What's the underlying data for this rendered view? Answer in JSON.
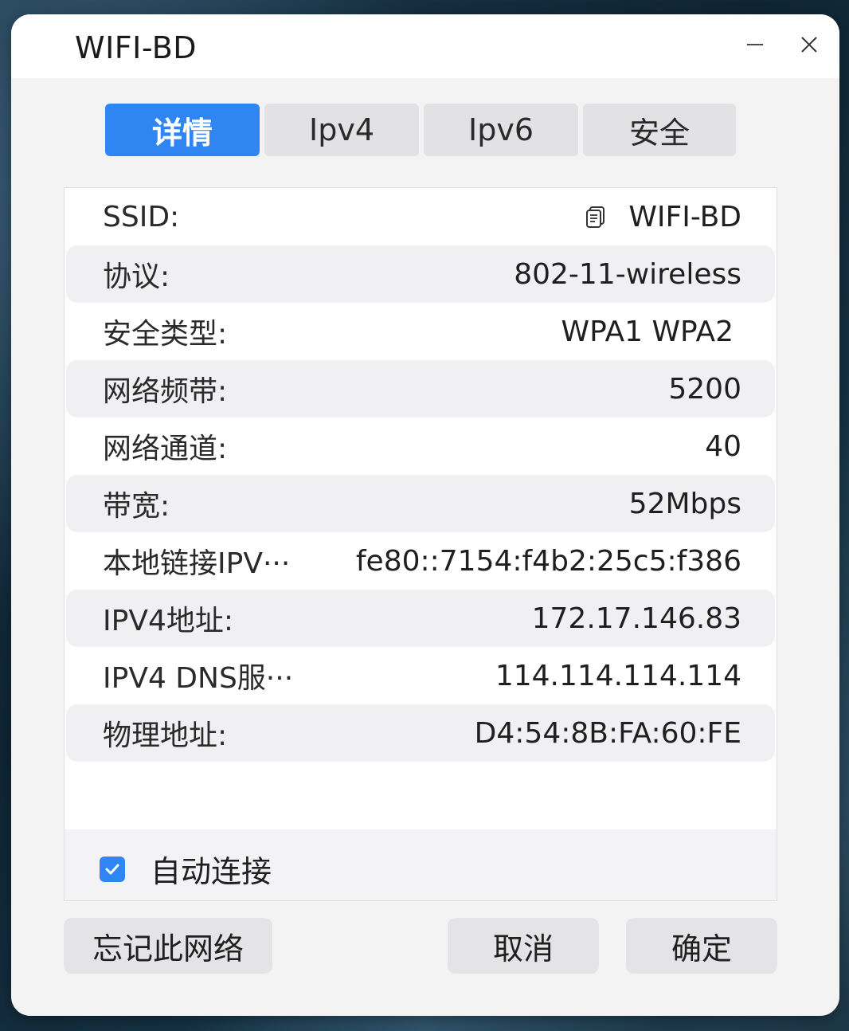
{
  "window": {
    "title": "WIFI-BD"
  },
  "tabs": [
    {
      "label": "详情",
      "active": true
    },
    {
      "label": "Ipv4",
      "active": false
    },
    {
      "label": "Ipv6",
      "active": false
    },
    {
      "label": "安全",
      "active": false
    }
  ],
  "details": [
    {
      "label": "SSID:",
      "value": "WIFI-BD",
      "copy_icon": "copy-icon"
    },
    {
      "label": "协议:",
      "value": "802-11-wireless"
    },
    {
      "label": "安全类型:",
      "value": "WPA1 WPA2"
    },
    {
      "label": "网络频带:",
      "value": "5200"
    },
    {
      "label": "网络通道:",
      "value": "40"
    },
    {
      "label": "带宽:",
      "value": "52Mbps"
    },
    {
      "label": "本地链接IPV···",
      "value": "fe80::7154:f4b2:25c5:f386"
    },
    {
      "label": "IPV4地址:",
      "value": "172.17.146.83"
    },
    {
      "label": "IPV4 DNS服···",
      "value": "114.114.114.114"
    },
    {
      "label": "物理地址:",
      "value": "D4:54:8B:FA:60:FE"
    }
  ],
  "auto_connect": {
    "label": "自动连接",
    "checked": true
  },
  "buttons": {
    "forget": "忘记此网络",
    "cancel": "取消",
    "ok": "确定"
  },
  "colors": {
    "accent": "#2f86f2",
    "window_bg": "#f3f3f4",
    "row_alt": "#f0f0f2"
  }
}
